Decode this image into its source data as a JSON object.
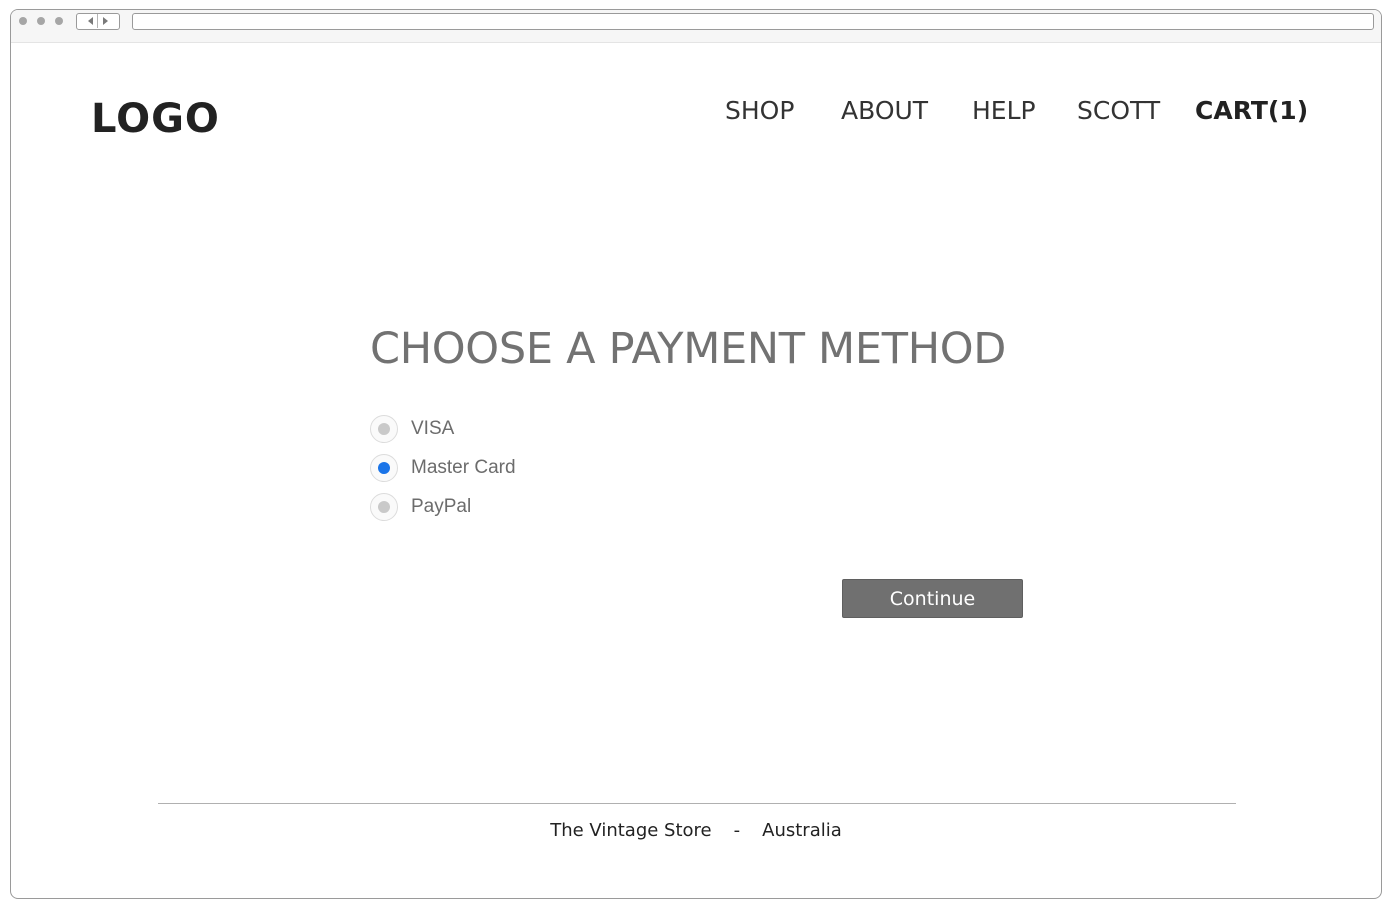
{
  "header": {
    "logo_text": "LOGO",
    "nav": {
      "shop": "SHOP",
      "about": "ABOUT",
      "help": "HELP",
      "user": "SCOTT",
      "cart": "CART(1)"
    }
  },
  "main": {
    "title": "CHOOSE A PAYMENT METHOD",
    "payment_options": [
      {
        "label": "VISA",
        "checked": false
      },
      {
        "label": "Master Card",
        "checked": true
      },
      {
        "label": "PayPal",
        "checked": false
      }
    ],
    "continue_label": "Continue"
  },
  "footer": {
    "store": "The Vintage Store",
    "separator": "-",
    "country": "Australia"
  },
  "colors": {
    "accent_radio": "#1a74e8",
    "button_bg": "#707070",
    "title_text": "#727272"
  },
  "icons": {
    "back": "chevron-left-icon",
    "forward": "chevron-right-icon"
  }
}
